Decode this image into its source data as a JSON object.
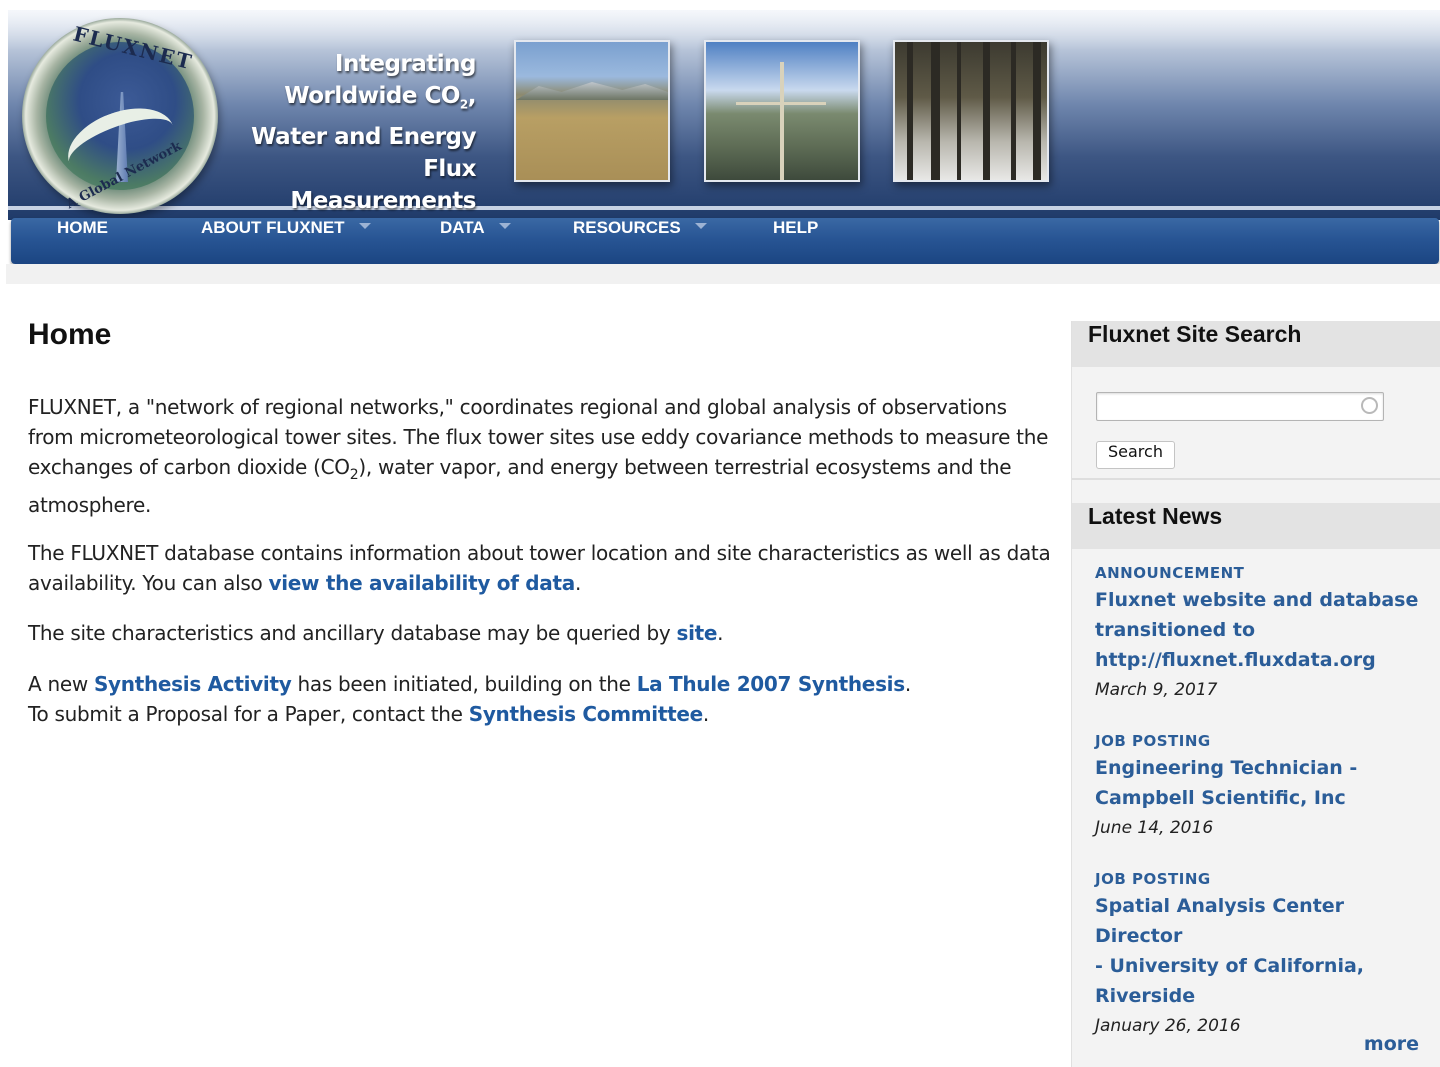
{
  "header": {
    "logo_top_text": "FLUXNET",
    "logo_bottom_text": "A Global Network",
    "tagline_lines": [
      "Integrating",
      "Worldwide CO",
      "Water and Energy",
      "Flux Measurements"
    ],
    "tagline_sub": "2",
    "tagline_comma": ","
  },
  "nav": {
    "items": [
      {
        "label": "HOME",
        "has_dropdown": false
      },
      {
        "label": "ABOUT FLUXNET",
        "has_dropdown": true
      },
      {
        "label": "DATA",
        "has_dropdown": true
      },
      {
        "label": "RESOURCES",
        "has_dropdown": true
      },
      {
        "label": "HELP",
        "has_dropdown": false
      }
    ]
  },
  "main": {
    "title": "Home",
    "p1": {
      "text_a": "FLUXNET, a \"network of regional networks,\" coordinates regional and global analysis of observations from micrometeorological tower sites. The flux tower sites use eddy covariance methods to measure the exchanges of carbon dioxide (CO",
      "sub": "2",
      "text_b": "), water vapor, and energy between terrestrial ecosystems and the atmosphere."
    },
    "p2": {
      "text_a": "The FLUXNET database contains information about tower location and site characteristics as well as data availability. You can also ",
      "link": "view the availability of data",
      "text_b": "."
    },
    "p3": {
      "text_a": "The site characteristics and ancillary database may be queried by ",
      "link": "site",
      "text_b": "."
    },
    "p4": {
      "text_a": "A new ",
      "link1": "Synthesis Activity",
      "text_b": " has been initiated, building on the ",
      "link2": "La Thule 2007 Synthesis",
      "text_c": ".",
      "text_d": "To submit a Proposal for a Paper, contact the ",
      "link3": "Synthesis Committee",
      "text_e": "."
    }
  },
  "sidebar": {
    "search_title": "Fluxnet Site Search",
    "search_value": "",
    "search_button": "Search",
    "news_title": "Latest News",
    "news": [
      {
        "category": "ANNOUNCEMENT",
        "title": "Fluxnet website and database transitioned to http://fluxnet.fluxdata.org",
        "lines": [
          "Fluxnet website and database",
          "transitioned to",
          "http://fluxnet.fluxdata.org"
        ],
        "date": "March 9, 2017"
      },
      {
        "category": "JOB POSTING",
        "title": "Engineering Technician - Campbell Scientific, Inc",
        "lines": [
          "Engineering Technician -",
          "Campbell Scientific, Inc"
        ],
        "date": "June 14, 2016"
      },
      {
        "category": "JOB POSTING",
        "title": "Spatial Analysis Center Director - University of California, Riverside",
        "lines": [
          "Spatial Analysis Center Director",
          "- University of California,",
          "Riverside"
        ],
        "date": "January 26, 2016"
      }
    ],
    "more_link": "more"
  },
  "colors": {
    "link": "#1f5aa0",
    "nav_bg": "#285594",
    "sidebar_bg": "#f3f3f3"
  }
}
